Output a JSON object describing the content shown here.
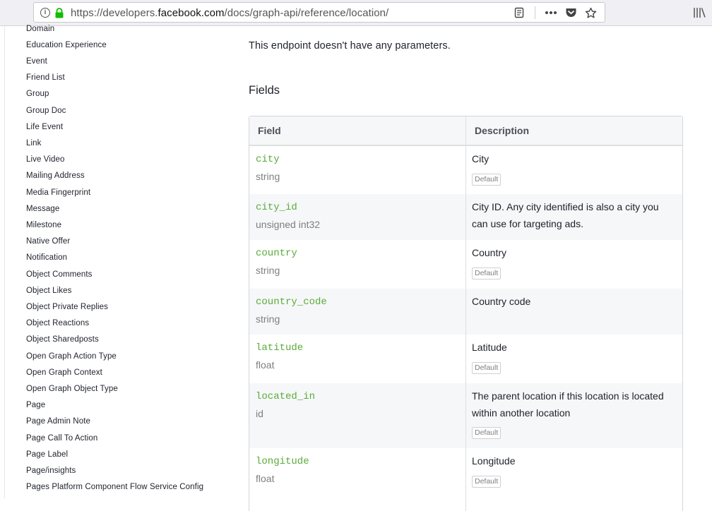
{
  "browser": {
    "url_prefix": "https://developers.",
    "url_host": "facebook.com",
    "url_path": "/docs/graph-api/reference/location/",
    "icons": [
      "info-icon",
      "lock-icon",
      "reader-view-icon",
      "more-actions-icon",
      "pocket-icon",
      "bookmark-star-icon",
      "library-icon"
    ]
  },
  "sidebar": {
    "items": [
      "Domain",
      "Education Experience",
      "Event",
      "Friend List",
      "Group",
      "Group Doc",
      "Life Event",
      "Link",
      "Live Video",
      "Mailing Address",
      "Media Fingerprint",
      "Message",
      "Milestone",
      "Native Offer",
      "Notification",
      "Object Comments",
      "Object Likes",
      "Object Private Replies",
      "Object Reactions",
      "Object Sharedposts",
      "Open Graph Action Type",
      "Open Graph Context",
      "Open Graph Object Type",
      "Page",
      "Page Admin Note",
      "Page Call To Action",
      "Page Label",
      "Page/insights",
      "Pages Platform Component Flow Service Config"
    ]
  },
  "main": {
    "no_params_text": "This endpoint doesn't have any parameters.",
    "fields_heading": "Fields",
    "table": {
      "headers": [
        "Field",
        "Description"
      ],
      "rows": [
        {
          "name": "city",
          "type": "string",
          "description": "City",
          "badge": "Default"
        },
        {
          "name": "city_id",
          "type": "unsigned int32",
          "description": "City ID. Any city identified is also a city you can use for targeting ads.",
          "badge": ""
        },
        {
          "name": "country",
          "type": "string",
          "description": "Country",
          "badge": "Default"
        },
        {
          "name": "country_code",
          "type": "string",
          "description": "Country code",
          "badge": ""
        },
        {
          "name": "latitude",
          "type": "float",
          "description": "Latitude",
          "badge": "Default"
        },
        {
          "name": "located_in",
          "type": "id",
          "description": "The parent location if this location is located within another location",
          "badge": "Default"
        },
        {
          "name": "longitude",
          "type": "float",
          "description": "Longitude",
          "badge": "Default"
        }
      ]
    }
  }
}
